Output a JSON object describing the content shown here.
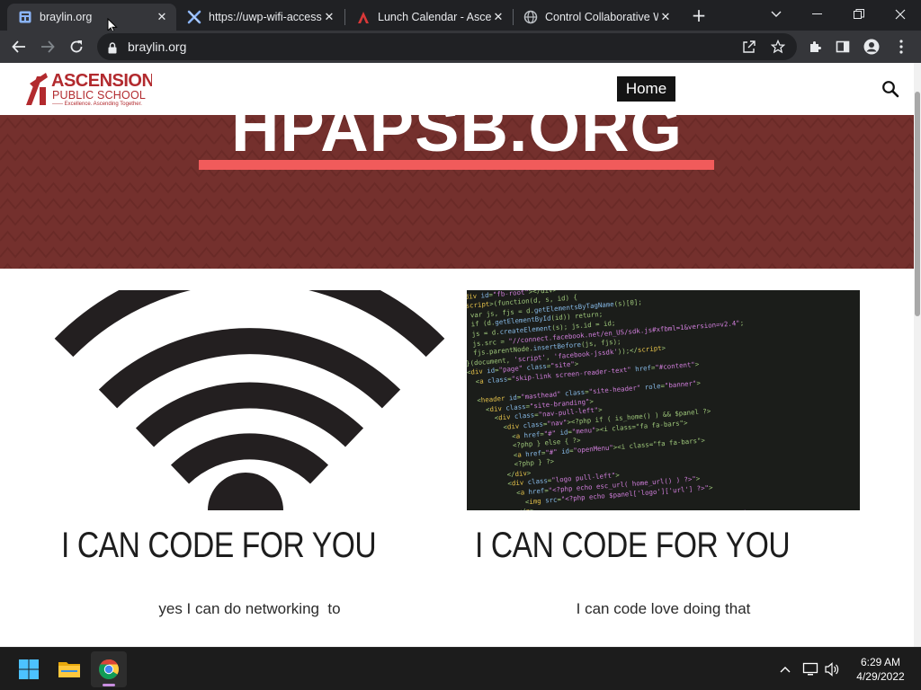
{
  "browser": {
    "tabs": [
      {
        "title": "braylin.org",
        "active": true,
        "icon": "site-grid-icon"
      },
      {
        "title": "https://uwp-wifi-access",
        "active": false,
        "icon": "x-logo-icon"
      },
      {
        "title": "Lunch Calendar - Ascen",
        "active": false,
        "icon": "ascension-logo-icon"
      },
      {
        "title": "Control Collaborative W",
        "active": false,
        "icon": "globe-icon"
      }
    ],
    "close_glyph": "✕",
    "new_tab_glyph": "+",
    "url": "braylin.org"
  },
  "site": {
    "logo": {
      "name": "ASCENSION",
      "sub": "PUBLIC SCHOOL",
      "tagline": "—— Excellence. Ascending Together."
    },
    "nav": {
      "home_label": "Home"
    },
    "hero": {
      "title": "HPAPSB.ORG"
    },
    "cards": [
      {
        "heading": "I CAN CODE FOR YOU",
        "body": "yes I can do networking  to",
        "image": "wifi-icon"
      },
      {
        "heading": "I CAN CODE FOR YOU",
        "body": "I can code love doing that",
        "image": "code-screenshot"
      }
    ]
  },
  "taskbar": {
    "time": "6:29 AM",
    "date": "4/29/2022"
  },
  "colors": {
    "hero_bg": "#74302d",
    "accent_bar": "#f15b5b",
    "brand_red": "#b22a2e",
    "nav_bg": "#141414"
  }
}
